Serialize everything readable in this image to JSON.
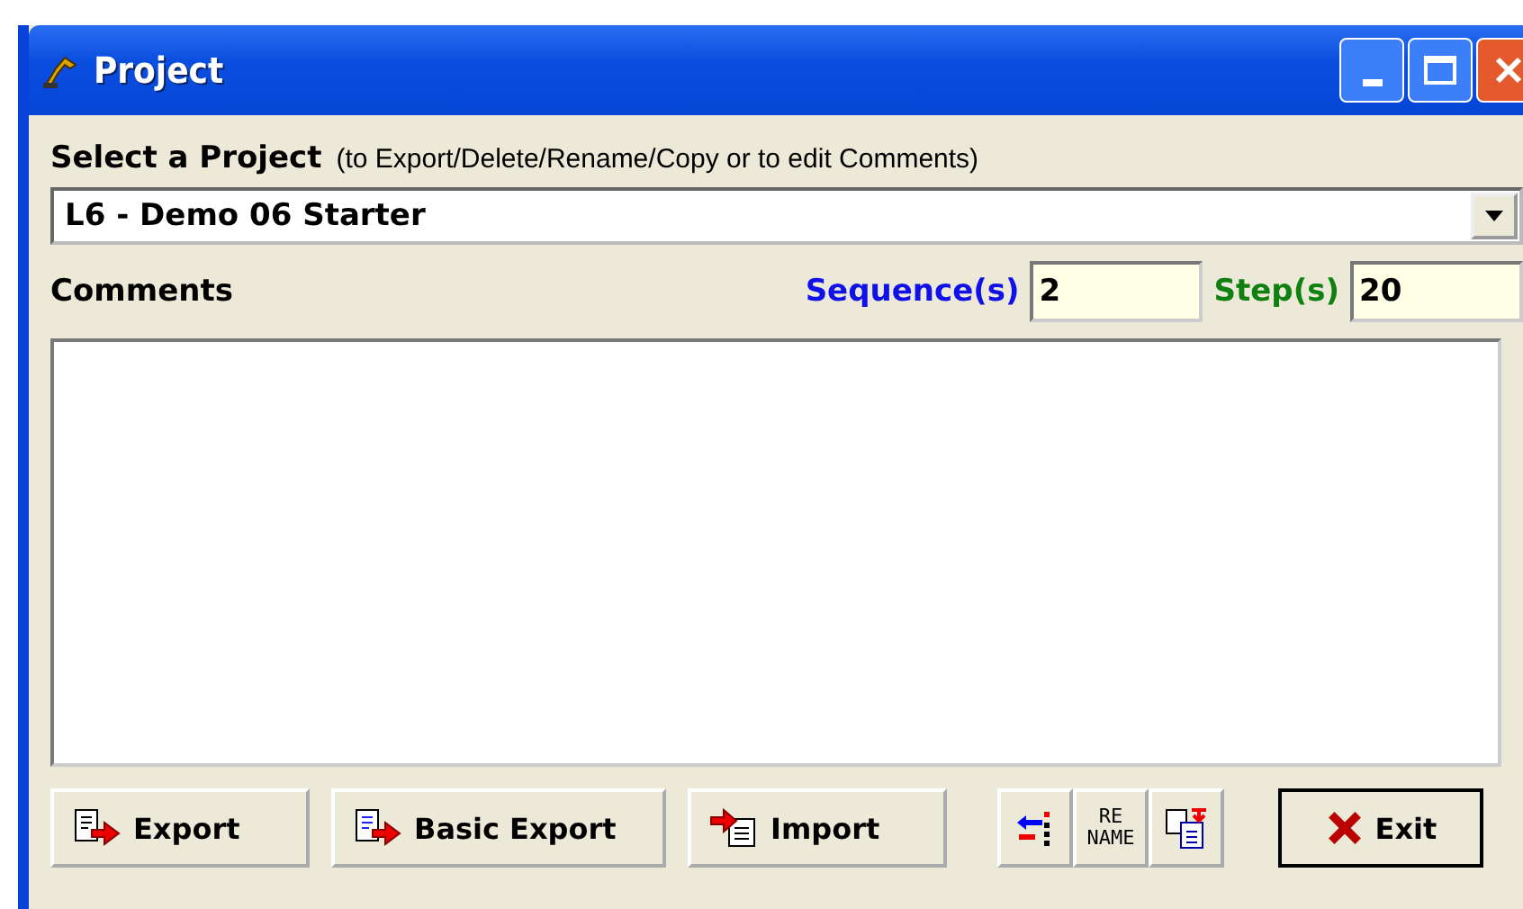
{
  "window": {
    "title": "Project"
  },
  "project": {
    "label": "Select a Project",
    "hint": "(to Export/Delete/Rename/Copy or to edit Comments)",
    "value": "L6 - Demo 06 Starter"
  },
  "comments": {
    "label": "Comments"
  },
  "sequences": {
    "label": "Sequence(s)",
    "value": "2"
  },
  "steps": {
    "label": "Step(s)",
    "value": "20"
  },
  "buttons": [
    {
      "kind": "export",
      "label": "Export"
    },
    {
      "kind": "basic-export",
      "label": "Basic Export"
    },
    {
      "kind": "import",
      "label": "Import"
    },
    {
      "kind": "delete"
    },
    {
      "kind": "rename",
      "label": "RE\nNAME"
    },
    {
      "kind": "copy"
    },
    {
      "kind": "exit",
      "label": "Exit"
    }
  ]
}
